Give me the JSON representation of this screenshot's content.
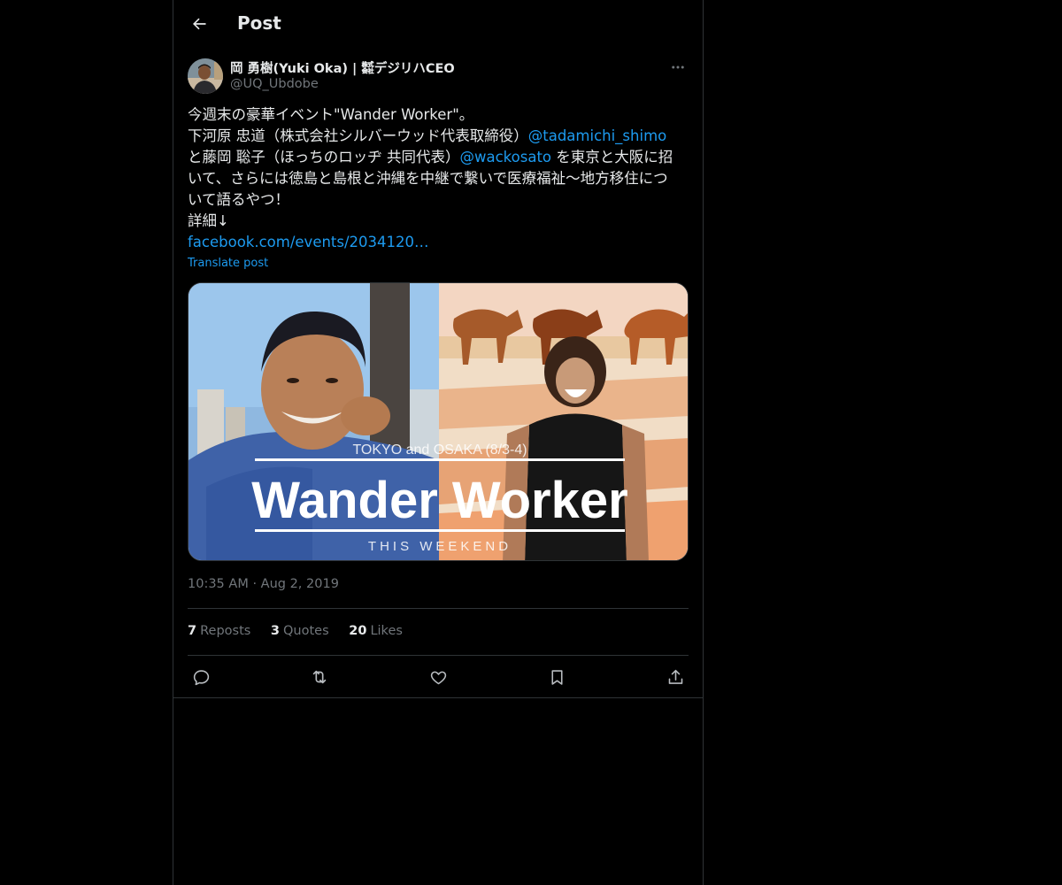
{
  "header": {
    "title": "Post",
    "back_icon": "arrow-left-icon"
  },
  "author": {
    "display_name": "岡 勇樹(Yuki Oka) | ㍿デジリハCEO",
    "handle": "@UQ_Ubdobe"
  },
  "post": {
    "line1": "今週末の豪華イベント\"Wander Worker\"。",
    "line2_text": "下河原 忠道（株式会社シルバーウッド代表取締役）",
    "line2_mention": "@tadamichi_shimo",
    "line3_text": "と藤岡 聡子（ほっちのロッヂ 共同代表）",
    "line3_mention": "@wackosato",
    "line3_tail": " を東京と大阪に招",
    "line4": "いて、さらには徳島と島根と沖縄を中継で繋いで医療福祉〜地方移住につ",
    "line5": "いて語るやつ！",
    "line6": "詳細↓",
    "link": "facebook.com/events/2034120…",
    "translate_label": "Translate post"
  },
  "media": {
    "subtitle": "TOKYO and OSAKA (8/3-4)",
    "title": "Wander Worker",
    "tagline": "THIS WEEKEND"
  },
  "meta": {
    "time": "10:35 AM",
    "separator": "·",
    "date": "Aug 2, 2019"
  },
  "stats": {
    "reposts_count": "7",
    "reposts_label": "Reposts",
    "quotes_count": "3",
    "quotes_label": "Quotes",
    "likes_count": "20",
    "likes_label": "Likes"
  },
  "colors": {
    "background": "#000000",
    "text": "#e7e9ea",
    "secondary": "#71767b",
    "accent": "#1d9bf0",
    "border": "#2f3336"
  },
  "icons": [
    "arrow-left-icon",
    "more-icon",
    "reply-icon",
    "repost-icon",
    "like-icon",
    "bookmark-icon",
    "share-icon"
  ]
}
